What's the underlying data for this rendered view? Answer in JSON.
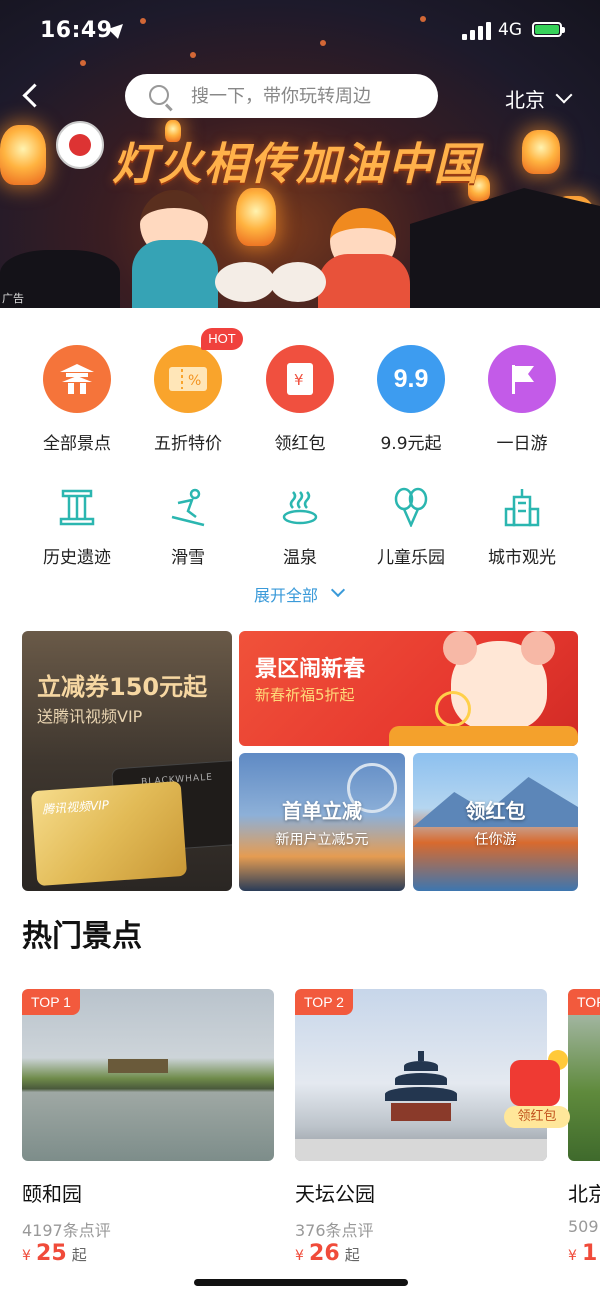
{
  "status_bar": {
    "time": "16:49",
    "network": "4G"
  },
  "header": {
    "search_placeholder": "搜一下，带你玩转周边",
    "city": "北京"
  },
  "banner": {
    "title": "灯火相传加油中国",
    "ad_tag": "广告"
  },
  "categories_primary": [
    {
      "label": "全部景点",
      "icon": "pagoda-icon",
      "color": "#f5743a"
    },
    {
      "label": "五折特价",
      "icon": "discount-ticket-icon",
      "color": "#f9a42c",
      "badge": "HOT"
    },
    {
      "label": "领红包",
      "icon": "red-packet-icon",
      "color": "#f0503f"
    },
    {
      "label": "9.9元起",
      "icon": "nine-nine-icon",
      "icon_text": "9.9",
      "color": "#3d9cf0"
    },
    {
      "label": "一日游",
      "icon": "flag-icon",
      "color": "#c35be8"
    }
  ],
  "categories_secondary": [
    {
      "label": "历史遗迹",
      "icon": "column-icon"
    },
    {
      "label": "滑雪",
      "icon": "skiing-icon"
    },
    {
      "label": "温泉",
      "icon": "hot-spring-icon"
    },
    {
      "label": "儿童乐园",
      "icon": "balloons-icon"
    },
    {
      "label": "城市观光",
      "icon": "city-building-icon"
    }
  ],
  "expand_label": "展开全部",
  "promos": {
    "voucher": {
      "title": "立减券150元起",
      "subtitle": "送腾讯视频VIP",
      "card_text": "腾讯视频VIP",
      "black_card_text": "BLACKWHALE"
    },
    "new_year": {
      "title": "景区闹新春",
      "subtitle": "新春祈福5折起"
    },
    "first_order": {
      "title": "首单立减",
      "subtitle": "新用户立减5元"
    },
    "red_packet": {
      "title": "领红包",
      "subtitle": "任你游"
    }
  },
  "hot_section": {
    "title": "热门景点",
    "spots": [
      {
        "rank": "TOP 1",
        "name": "颐和园",
        "reviews": "4197条点评",
        "currency": "¥",
        "price": "25",
        "suffix": "起"
      },
      {
        "rank": "TOP 2",
        "name": "天坛公园",
        "reviews": "376条点评",
        "currency": "¥",
        "price": "26",
        "suffix": "起"
      },
      {
        "rank": "TOP",
        "name": "北京",
        "reviews": "509",
        "currency": "¥",
        "price": "1",
        "suffix": ""
      }
    ],
    "floating_redpack_label": "领红包"
  },
  "colors": {
    "accent_blue": "#3a9ad9",
    "price_red": "#f04b3a",
    "badge_red": "#f25a3d"
  }
}
